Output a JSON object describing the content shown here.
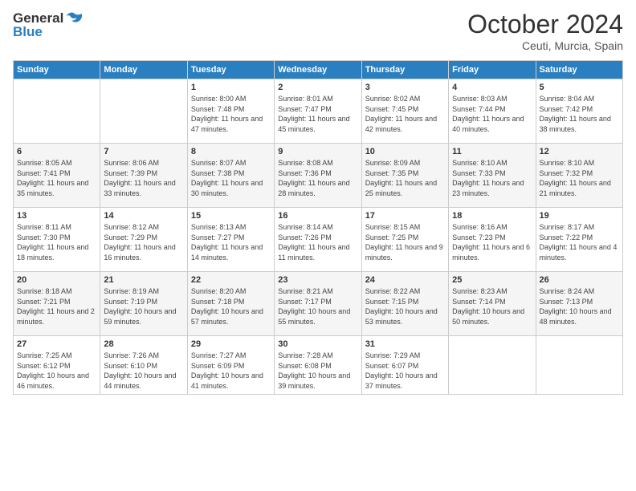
{
  "logo": {
    "text_general": "General",
    "text_blue": "Blue"
  },
  "header": {
    "month_year": "October 2024",
    "location": "Ceuti, Murcia, Spain"
  },
  "days_of_week": [
    "Sunday",
    "Monday",
    "Tuesday",
    "Wednesday",
    "Thursday",
    "Friday",
    "Saturday"
  ],
  "weeks": [
    [
      {
        "day": "",
        "info": ""
      },
      {
        "day": "",
        "info": ""
      },
      {
        "day": "1",
        "info": "Sunrise: 8:00 AM\nSunset: 7:48 PM\nDaylight: 11 hours and 47 minutes."
      },
      {
        "day": "2",
        "info": "Sunrise: 8:01 AM\nSunset: 7:47 PM\nDaylight: 11 hours and 45 minutes."
      },
      {
        "day": "3",
        "info": "Sunrise: 8:02 AM\nSunset: 7:45 PM\nDaylight: 11 hours and 42 minutes."
      },
      {
        "day": "4",
        "info": "Sunrise: 8:03 AM\nSunset: 7:44 PM\nDaylight: 11 hours and 40 minutes."
      },
      {
        "day": "5",
        "info": "Sunrise: 8:04 AM\nSunset: 7:42 PM\nDaylight: 11 hours and 38 minutes."
      }
    ],
    [
      {
        "day": "6",
        "info": "Sunrise: 8:05 AM\nSunset: 7:41 PM\nDaylight: 11 hours and 35 minutes."
      },
      {
        "day": "7",
        "info": "Sunrise: 8:06 AM\nSunset: 7:39 PM\nDaylight: 11 hours and 33 minutes."
      },
      {
        "day": "8",
        "info": "Sunrise: 8:07 AM\nSunset: 7:38 PM\nDaylight: 11 hours and 30 minutes."
      },
      {
        "day": "9",
        "info": "Sunrise: 8:08 AM\nSunset: 7:36 PM\nDaylight: 11 hours and 28 minutes."
      },
      {
        "day": "10",
        "info": "Sunrise: 8:09 AM\nSunset: 7:35 PM\nDaylight: 11 hours and 25 minutes."
      },
      {
        "day": "11",
        "info": "Sunrise: 8:10 AM\nSunset: 7:33 PM\nDaylight: 11 hours and 23 minutes."
      },
      {
        "day": "12",
        "info": "Sunrise: 8:10 AM\nSunset: 7:32 PM\nDaylight: 11 hours and 21 minutes."
      }
    ],
    [
      {
        "day": "13",
        "info": "Sunrise: 8:11 AM\nSunset: 7:30 PM\nDaylight: 11 hours and 18 minutes."
      },
      {
        "day": "14",
        "info": "Sunrise: 8:12 AM\nSunset: 7:29 PM\nDaylight: 11 hours and 16 minutes."
      },
      {
        "day": "15",
        "info": "Sunrise: 8:13 AM\nSunset: 7:27 PM\nDaylight: 11 hours and 14 minutes."
      },
      {
        "day": "16",
        "info": "Sunrise: 8:14 AM\nSunset: 7:26 PM\nDaylight: 11 hours and 11 minutes."
      },
      {
        "day": "17",
        "info": "Sunrise: 8:15 AM\nSunset: 7:25 PM\nDaylight: 11 hours and 9 minutes."
      },
      {
        "day": "18",
        "info": "Sunrise: 8:16 AM\nSunset: 7:23 PM\nDaylight: 11 hours and 6 minutes."
      },
      {
        "day": "19",
        "info": "Sunrise: 8:17 AM\nSunset: 7:22 PM\nDaylight: 11 hours and 4 minutes."
      }
    ],
    [
      {
        "day": "20",
        "info": "Sunrise: 8:18 AM\nSunset: 7:21 PM\nDaylight: 11 hours and 2 minutes."
      },
      {
        "day": "21",
        "info": "Sunrise: 8:19 AM\nSunset: 7:19 PM\nDaylight: 10 hours and 59 minutes."
      },
      {
        "day": "22",
        "info": "Sunrise: 8:20 AM\nSunset: 7:18 PM\nDaylight: 10 hours and 57 minutes."
      },
      {
        "day": "23",
        "info": "Sunrise: 8:21 AM\nSunset: 7:17 PM\nDaylight: 10 hours and 55 minutes."
      },
      {
        "day": "24",
        "info": "Sunrise: 8:22 AM\nSunset: 7:15 PM\nDaylight: 10 hours and 53 minutes."
      },
      {
        "day": "25",
        "info": "Sunrise: 8:23 AM\nSunset: 7:14 PM\nDaylight: 10 hours and 50 minutes."
      },
      {
        "day": "26",
        "info": "Sunrise: 8:24 AM\nSunset: 7:13 PM\nDaylight: 10 hours and 48 minutes."
      }
    ],
    [
      {
        "day": "27",
        "info": "Sunrise: 7:25 AM\nSunset: 6:12 PM\nDaylight: 10 hours and 46 minutes."
      },
      {
        "day": "28",
        "info": "Sunrise: 7:26 AM\nSunset: 6:10 PM\nDaylight: 10 hours and 44 minutes."
      },
      {
        "day": "29",
        "info": "Sunrise: 7:27 AM\nSunset: 6:09 PM\nDaylight: 10 hours and 41 minutes."
      },
      {
        "day": "30",
        "info": "Sunrise: 7:28 AM\nSunset: 6:08 PM\nDaylight: 10 hours and 39 minutes."
      },
      {
        "day": "31",
        "info": "Sunrise: 7:29 AM\nSunset: 6:07 PM\nDaylight: 10 hours and 37 minutes."
      },
      {
        "day": "",
        "info": ""
      },
      {
        "day": "",
        "info": ""
      }
    ]
  ]
}
